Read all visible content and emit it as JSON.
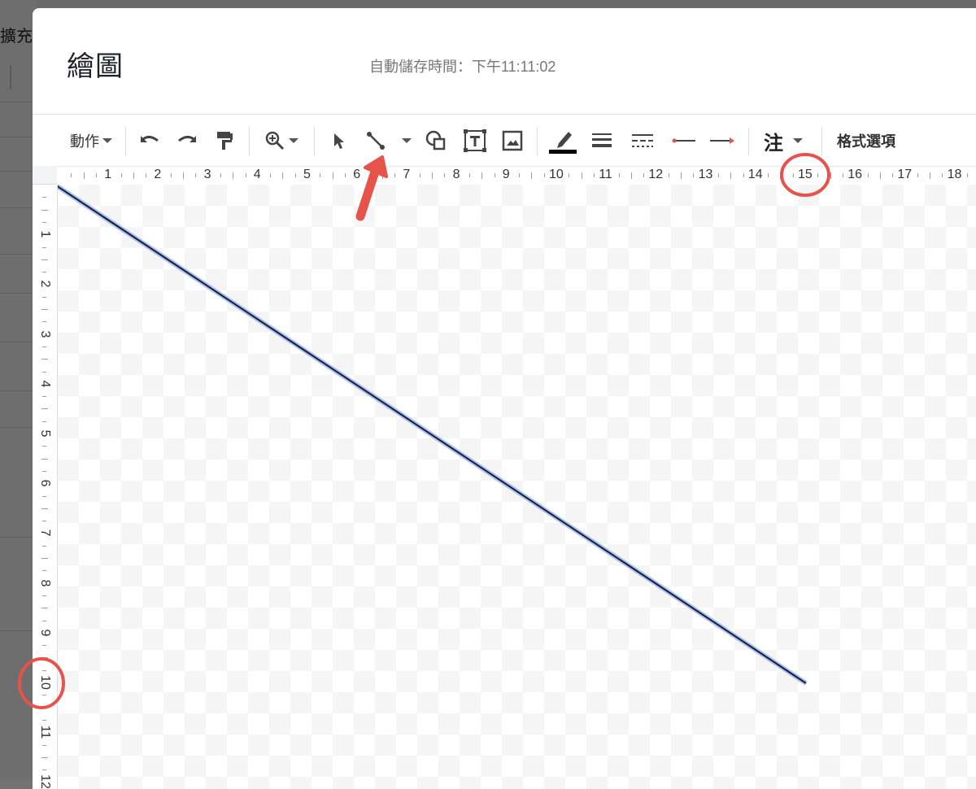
{
  "background": {
    "partial_label": "擴充"
  },
  "dialog": {
    "title": "繪圖",
    "autosave": "自動儲存時間：下午11:11:02"
  },
  "toolbar": {
    "actions_label": "動作",
    "undo_icon": "undo-icon",
    "redo_icon": "redo-icon",
    "paint_format_icon": "paint-format-icon",
    "zoom_icon": "zoom-icon",
    "select_icon": "select-arrow-icon",
    "line_icon": "line-icon",
    "shape_icon": "shape-icon",
    "textbox_icon": "textbox-icon",
    "image_icon": "image-icon",
    "line_color_icon": "line-color-icon",
    "line_weight_icon": "line-weight-icon",
    "line_dash_icon": "line-dash-icon",
    "line_start_icon": "line-start-icon",
    "line_end_icon": "line-end-icon",
    "wordart_label": "注",
    "format_options_label": "格式選項"
  },
  "ruler": {
    "top_numbers": [
      "1",
      "2",
      "3",
      "4",
      "5",
      "6",
      "7",
      "8",
      "9",
      "10",
      "11",
      "12",
      "13",
      "14",
      "15",
      "16",
      "17",
      "18"
    ],
    "left_numbers": [
      "1",
      "2",
      "3",
      "4",
      "5",
      "6",
      "7",
      "8",
      "9",
      "10",
      "11",
      "12"
    ]
  },
  "colors": {
    "accent_red": "#e5534b",
    "line_color": "#1a1a3a",
    "line_selection": "#a8c1f0"
  }
}
